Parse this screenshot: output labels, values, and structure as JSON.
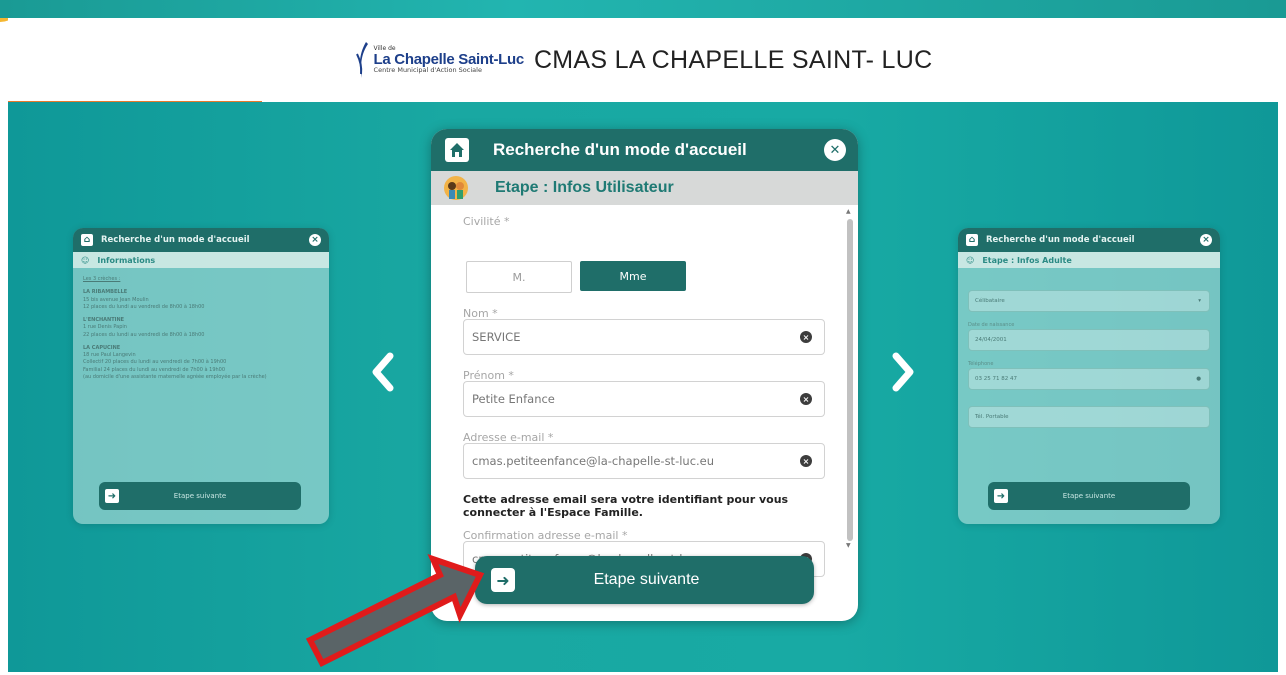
{
  "header": {
    "logo_small": "Ville de",
    "logo_name": "La Chapelle Saint-Luc",
    "logo_sub": "Centre Municipal d'Action Sociale",
    "title": "CMAS LA CHAPELLE SAINT- LUC"
  },
  "modal": {
    "title": "Recherche d'un mode d'accueil",
    "step": "Etape : Infos Utilisateur",
    "civilite_label": "Civilité *",
    "civilite_options": [
      "M.",
      "Mme"
    ],
    "civilite_selected": "Mme",
    "nom_label": "Nom *",
    "nom_value": "SERVICE",
    "prenom_label": "Prénom *",
    "prenom_value": "Petite Enfance",
    "email_label": "Adresse e-mail *",
    "email_value": "cmas.petiteenfance@la-chapelle-st-luc.eu",
    "email_note": "Cette adresse email sera votre identifiant pour vous connecter à l'Espace Famille.",
    "confirm_label": "Confirmation adresse e-mail *",
    "confirm_value": "cmas.petiteenfance@la-chapelle-st-luc.eu",
    "next_label": "Etape suivante"
  },
  "left_card": {
    "title": "Recherche d'un mode d'accueil",
    "step": "Informations",
    "intro": "Les 3 crèches :",
    "entries": [
      {
        "name": "LA RIBAMBELLE",
        "lines": [
          "15 bis avenue Jean Moulin",
          "12 places du lundi au vendredi de 8h00 à 18h00"
        ]
      },
      {
        "name": "L'ENCHANTINE",
        "lines": [
          "1 rue Denis Papin",
          "22 places du lundi au vendredi de 8h00 à 18h00"
        ]
      },
      {
        "name": "LA CAPUCINE",
        "lines": [
          "18 rue Paul Langevin",
          "Collectif 20 places du lundi au vendredi de 7h00 à 19h00",
          "Familial 24 places du lundi au vendredi de 7h00 à 19h00",
          "(au domicile d'une assistante maternelle agréée employée par la crèche)"
        ]
      }
    ],
    "next_label": "Etape suivante"
  },
  "right_card": {
    "title": "Recherche d'un mode d'accueil",
    "step": "Etape : Infos Adulte",
    "situation_value": "Célibataire",
    "birth_label": "Date de naissance",
    "birth_value": "24/04/2001",
    "phone_label": "Téléphone",
    "phone_value": "03 25 71 82 47",
    "mobile_placeholder": "Tél. Portable",
    "next_label": "Etape suivante"
  },
  "colors": {
    "primary": "#1f6e69",
    "background_teal": "#18aaa4",
    "accent_orange": "#e87a2c",
    "annotation_red": "#e01b1b"
  },
  "icons": {
    "home": "home-icon",
    "close": "close-icon",
    "next": "arrow-right-icon",
    "prev_nav": "chevron-left-icon",
    "next_nav": "chevron-right-icon"
  }
}
